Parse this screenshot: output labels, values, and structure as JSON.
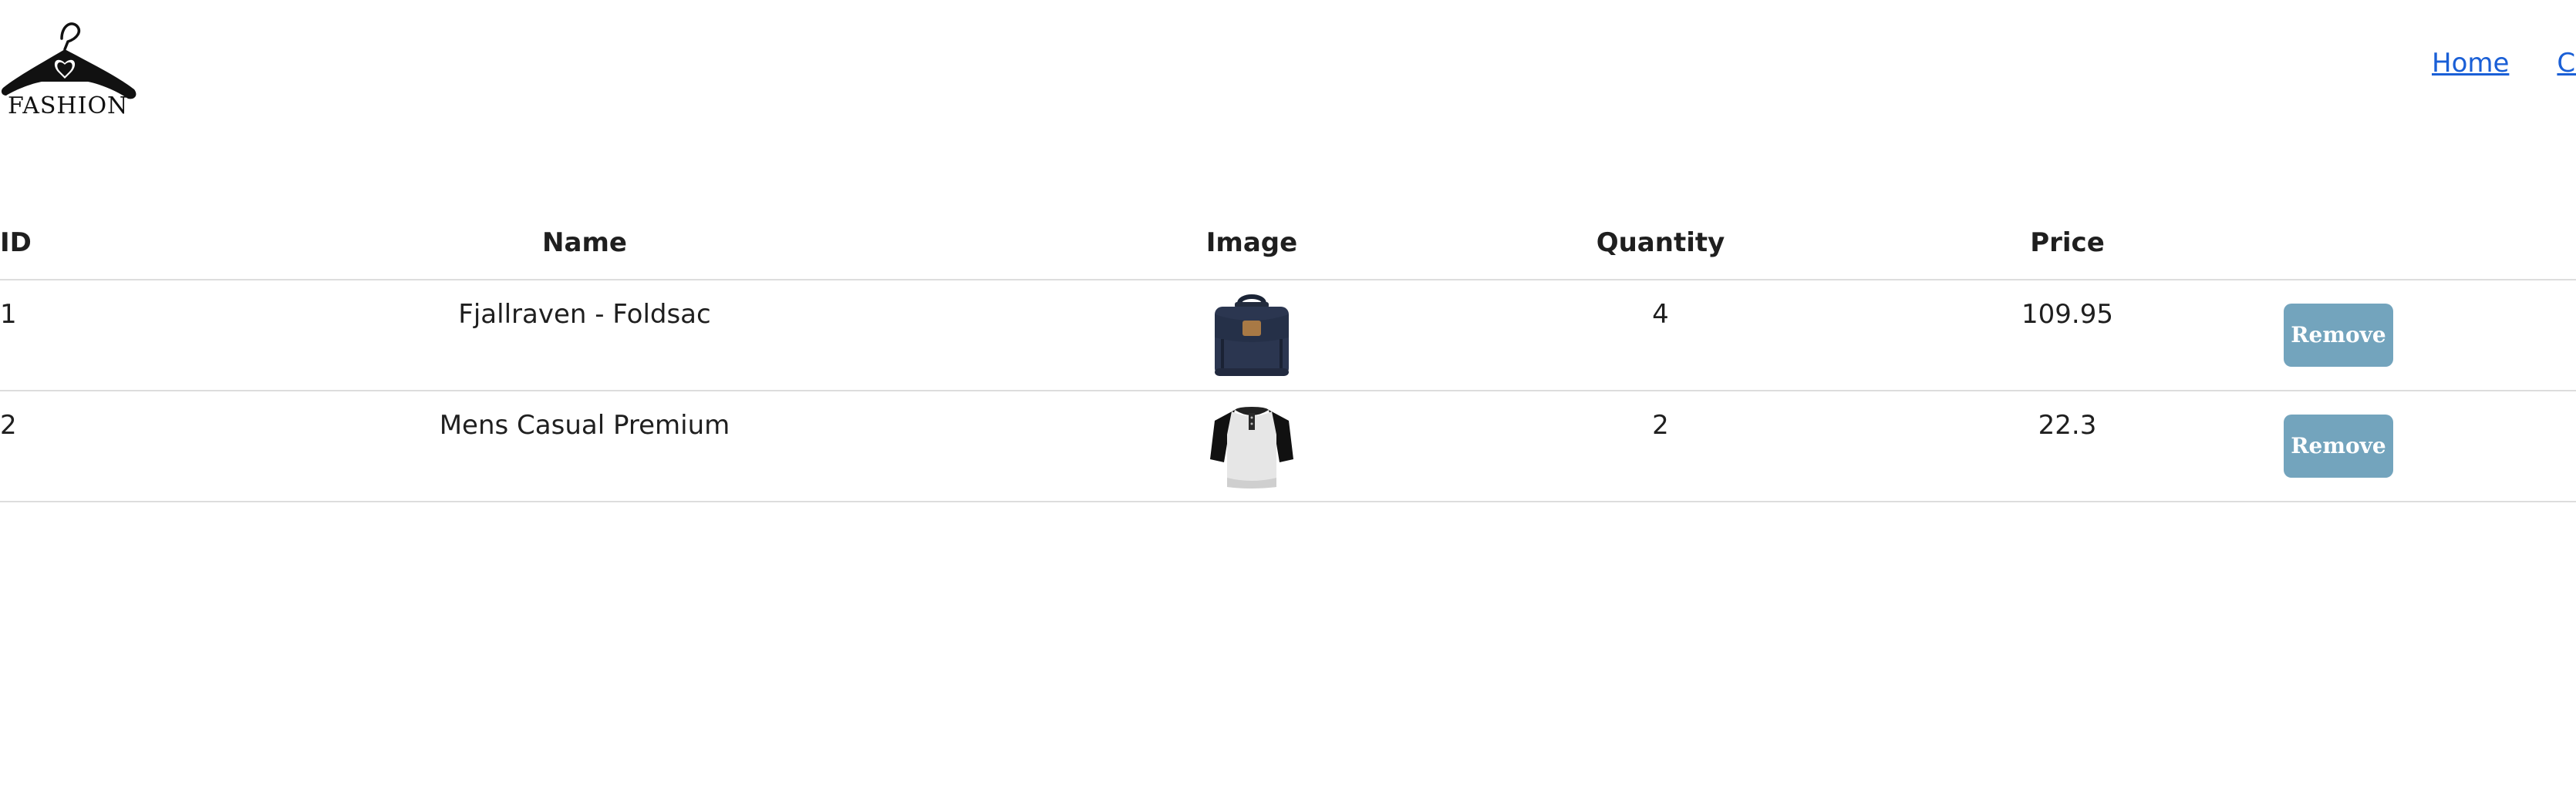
{
  "brand": {
    "logo_text": "FASHION"
  },
  "nav": {
    "items": [
      {
        "label": "Home"
      },
      {
        "label": "Cart"
      }
    ]
  },
  "table": {
    "headers": {
      "id": "ID",
      "name": "Name",
      "image": "Image",
      "quantity": "Quantity",
      "price": "Price"
    },
    "rows": [
      {
        "id": "1",
        "name": "Fjallraven - Foldsac",
        "image_icon": "backpack-icon",
        "quantity": "4",
        "price": "109.95",
        "action": "Remove"
      },
      {
        "id": "2",
        "name": "Mens Casual Premium",
        "image_icon": "tshirt-icon",
        "quantity": "2",
        "price": "22.3",
        "action": "Remove"
      }
    ]
  },
  "colors": {
    "link": "#1a5fd6",
    "remove_button": "#73a4bd",
    "border": "#dddddd"
  }
}
